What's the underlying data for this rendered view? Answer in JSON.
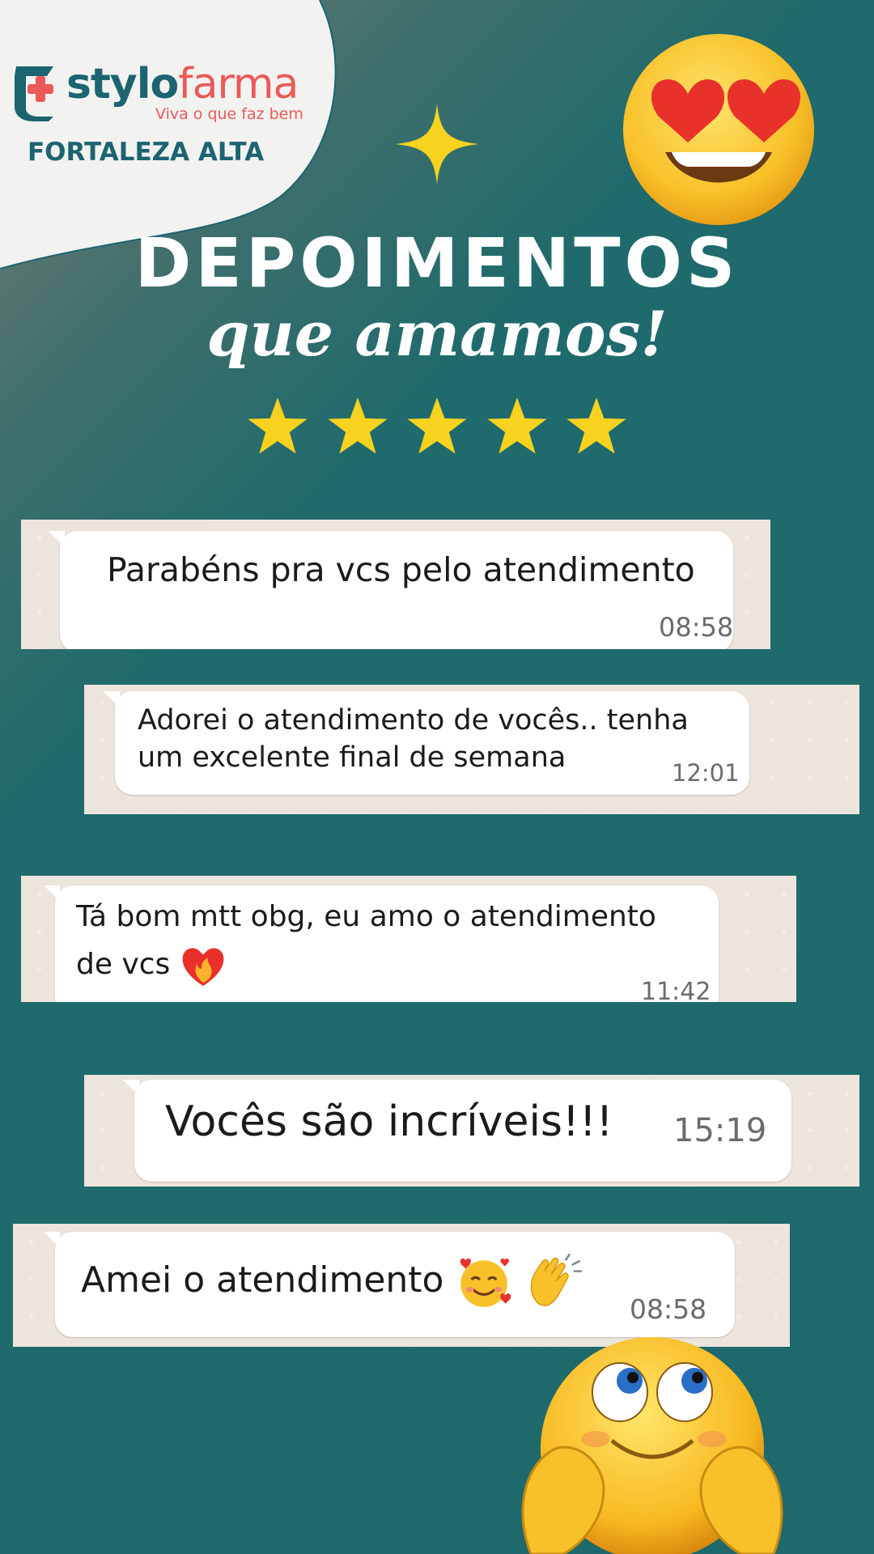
{
  "brand": {
    "name_part1": "stylo",
    "name_part2": "farma",
    "tagline": "Viva o que faz bem",
    "city": "FORTALEZA ALTA",
    "colors": {
      "teal": "#1b6470",
      "coral": "#ea5a58"
    }
  },
  "header": {
    "title": "DEPOIMENTOS",
    "subtitle": "que amamos!",
    "rating": 5,
    "star_color": "#f7d21f"
  },
  "testimonials": [
    {
      "text": "Parabéns pra vcs pelo atendimento",
      "time": "08:58"
    },
    {
      "line1": "Adorei o atendimento de vocês.. tenha",
      "line2": "um excelente final de semana",
      "time": "12:01"
    },
    {
      "line1": "Tá bom mtt obg, eu amo o atendimento",
      "line2": "de vcs",
      "emoji": "heart-on-fire-icon",
      "time": "11:42"
    },
    {
      "text": "Vocês são incríveis!!!",
      "time": "15:19"
    },
    {
      "text": "Amei o atendimento",
      "emojis": [
        "smiling-face-with-hearts-icon",
        "clapping-hands-icon"
      ],
      "time": "08:58"
    }
  ],
  "decorations": [
    "sparkle-icon",
    "heart-eyes-emoji",
    "shy-smiley-emoji"
  ],
  "colors": {
    "background": "#1d696b",
    "chat_bg": "#ece5dd",
    "bubble": "#ffffff"
  }
}
